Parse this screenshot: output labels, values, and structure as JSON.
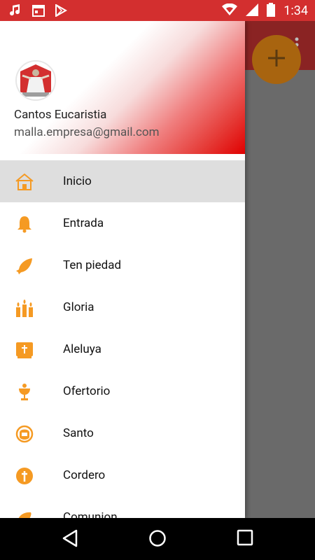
{
  "status_bar": {
    "time": "1:34",
    "icons": [
      "music-note-icon",
      "calendar-icon",
      "play-store-icon",
      "wifi-icon",
      "signal-icon",
      "battery-icon"
    ]
  },
  "header": {
    "name": "Cantos Eucaristia",
    "email": "malla.empresa@gmail.com"
  },
  "menu": {
    "items": [
      {
        "label": "Inicio",
        "icon": "church-icon",
        "active": true
      },
      {
        "label": "Entrada",
        "icon": "bell-icon"
      },
      {
        "label": "Ten piedad",
        "icon": "fish-icon"
      },
      {
        "label": "Gloria",
        "icon": "candles-icon"
      },
      {
        "label": "Aleluya",
        "icon": "bible-icon"
      },
      {
        "label": "Ofertorio",
        "icon": "chalice-icon"
      },
      {
        "label": "Santo",
        "icon": "saint-face-icon"
      },
      {
        "label": "Cordero",
        "icon": "cross-circle-icon"
      },
      {
        "label": "Comunion",
        "icon": "bread-icon"
      }
    ]
  },
  "colors": {
    "status_bar": "#d32f2f",
    "accent_orange": "#f59a23",
    "active_row": "#dedede"
  },
  "nav_bar": {
    "buttons": [
      "back-icon",
      "home-icon",
      "recents-icon"
    ]
  }
}
